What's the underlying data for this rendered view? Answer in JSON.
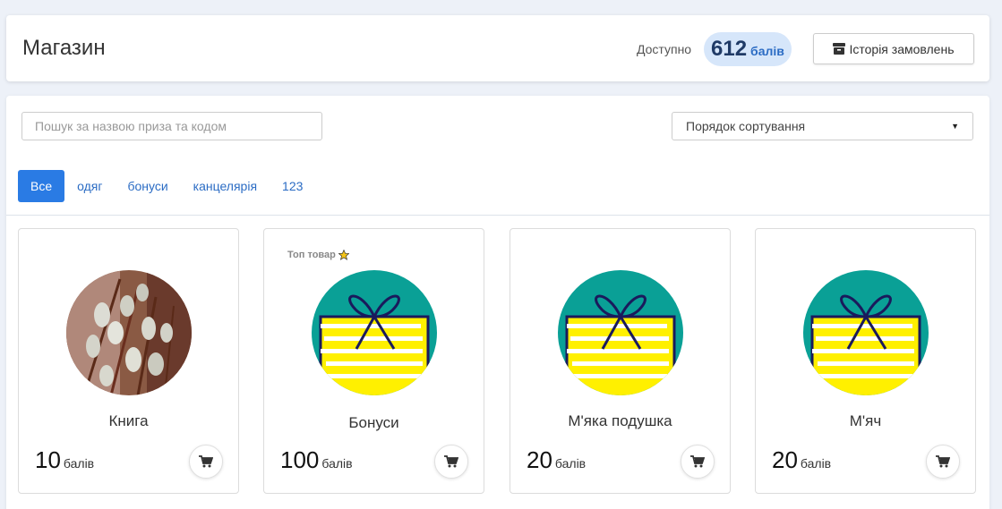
{
  "header": {
    "title": "Магазин",
    "available_label": "Доступно",
    "points_value": "612",
    "points_unit": "балів",
    "history_button": "Історія замовлень"
  },
  "filters": {
    "search_placeholder": "Пошук за назвою приза та кодом",
    "sort_label": "Порядок сортування"
  },
  "tabs": [
    "Все",
    "одяг",
    "бонуси",
    "канцелярія",
    "123"
  ],
  "products": [
    {
      "name": "Книга",
      "price": "10",
      "unit": "балів",
      "image": "willow-photo"
    },
    {
      "name": "Бонуси",
      "price": "100",
      "unit": "балів",
      "image": "gift-icon",
      "badge": "Топ товар"
    },
    {
      "name": "М'яка подушка",
      "price": "20",
      "unit": "балів",
      "image": "gift-icon"
    },
    {
      "name": "М'яч",
      "price": "20",
      "unit": "балів",
      "image": "gift-icon"
    }
  ],
  "colors": {
    "accent": "#2a7be4",
    "points_pill": "#d6e6fa",
    "gift_teal": "#0aa096",
    "gift_yellow": "#fff000",
    "ribbon_navy": "#1a1a5c"
  }
}
